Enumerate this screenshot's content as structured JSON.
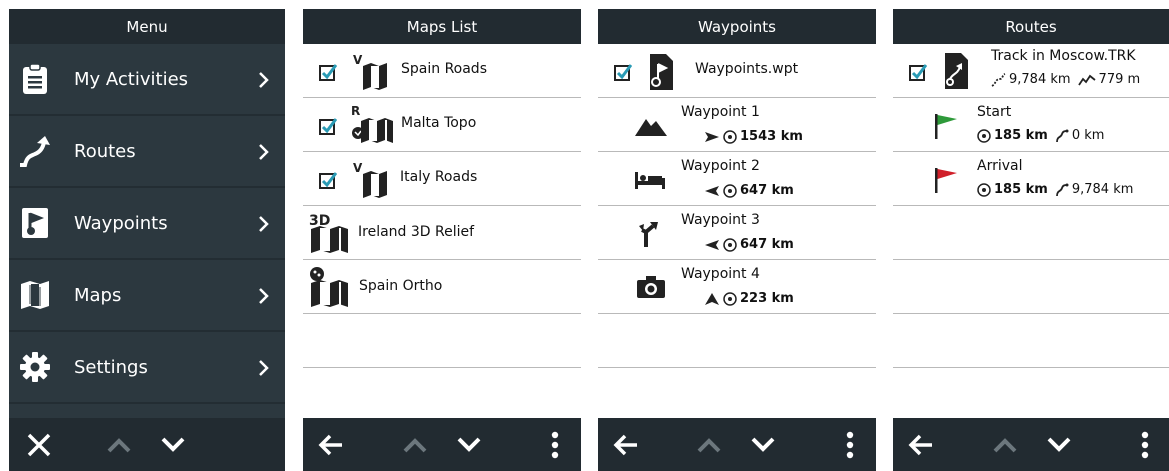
{
  "screens": {
    "menu": {
      "title": "Menu",
      "items": [
        {
          "label": "My Activities",
          "icon": "clipboard-icon"
        },
        {
          "label": "Routes",
          "icon": "route-icon"
        },
        {
          "label": "Waypoints",
          "icon": "waypoint-flag-icon"
        },
        {
          "label": "Maps",
          "icon": "map-icon"
        },
        {
          "label": "Settings",
          "icon": "gear-icon"
        }
      ]
    },
    "maps": {
      "title": "Maps List",
      "items": [
        {
          "label": "Spain Roads",
          "checked": true,
          "badge": "V"
        },
        {
          "label": "Malta Topo",
          "checked": true,
          "badge": "R"
        },
        {
          "label": "Italy Roads",
          "checked": true,
          "badge": "V"
        },
        {
          "label": "Ireland 3D Relief",
          "checked": false,
          "badge": "3D"
        },
        {
          "label": "Spain Ortho",
          "checked": false,
          "badge": "satellite"
        }
      ]
    },
    "waypoints": {
      "title": "Waypoints",
      "file": "Waypoints.wpt",
      "items": [
        {
          "name": "Waypoint 1",
          "icon": "mountain-icon",
          "distance": "1543 km"
        },
        {
          "name": "Waypoint 2",
          "icon": "bed-icon",
          "distance": "647 km"
        },
        {
          "name": "Waypoint 3",
          "icon": "junction-icon",
          "distance": "647 km"
        },
        {
          "name": "Waypoint 4",
          "icon": "camera-icon",
          "distance": "223 km"
        }
      ]
    },
    "routes": {
      "title": "Routes",
      "track": {
        "name": "Track in Moscow.TRK",
        "length": "9,784 km",
        "elevation": "779 m"
      },
      "points": [
        {
          "name": "Start",
          "flag_color": "#2e9a3a",
          "distance": "185 km",
          "route_dist": "0 km"
        },
        {
          "name": "Arrival",
          "flag_color": "#d0202a",
          "distance": "185 km",
          "route_dist": "9,784 km"
        }
      ]
    }
  },
  "colors": {
    "icon_dark": "#222222",
    "checkbox": "#2a9bb5",
    "panel_dark": "#2c383f",
    "bar_dark": "#222b31"
  }
}
